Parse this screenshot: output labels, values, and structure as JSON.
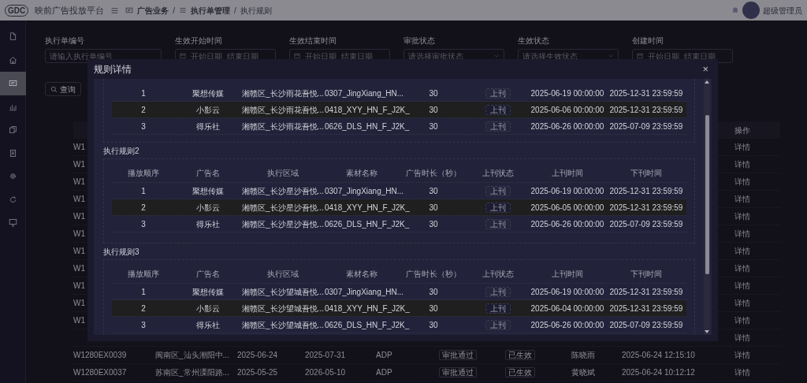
{
  "header": {
    "logo": "GDC",
    "app_title": "映前广告投放平台",
    "breadcrumb": [
      {
        "label": "广告业务",
        "kind": "board"
      },
      {
        "separator": "/",
        "label": "执行单管理",
        "kind": "list"
      },
      {
        "separator": "/",
        "label": "执行规则",
        "kind": "none"
      }
    ],
    "user": "超级管理员"
  },
  "sidebar": {
    "items": [
      {
        "kind": "document",
        "selected": false
      },
      {
        "kind": "home",
        "selected": false
      },
      {
        "kind": "board",
        "selected": true
      },
      {
        "kind": "chart",
        "selected": false
      },
      {
        "kind": "copy",
        "selected": false
      },
      {
        "kind": "files",
        "selected": false
      },
      {
        "kind": "gear",
        "selected": false
      },
      {
        "kind": "refresh",
        "selected": false
      },
      {
        "kind": "monitor",
        "selected": false
      }
    ]
  },
  "filters": [
    {
      "label": "执行单编号",
      "kind": "text",
      "placeholder": "请输入执行单编号"
    },
    {
      "label": "生效开始时间",
      "kind": "daterange",
      "start": "开始日期",
      "end": "结束日期"
    },
    {
      "label": "生效结束时间",
      "kind": "daterange",
      "start": "开始日期",
      "end": "结束日期"
    },
    {
      "label": "审批状态",
      "kind": "select",
      "placeholder": "请选择审批状态"
    },
    {
      "label": "生效状态",
      "kind": "select",
      "placeholder": "请选择生效状态"
    },
    {
      "label": "创建时间",
      "kind": "daterange",
      "start": "开始日期",
      "end": "结束日期"
    }
  ],
  "query_button": "查询",
  "table": {
    "action_column": "操作",
    "rows": [
      {
        "column_1": "W1",
        "action": "详情"
      },
      {
        "column_1": "W1",
        "action": "详情"
      },
      {
        "column_1": "W1",
        "action": "详情"
      },
      {
        "column_1": "W1",
        "action": "详情"
      },
      {
        "column_1": "W1",
        "action": "详情"
      },
      {
        "column_1": "W1",
        "action": "详情"
      },
      {
        "column_1": "W1",
        "action": "详情"
      },
      {
        "column_1": "W1",
        "action": "详情"
      },
      {
        "column_1": "W1",
        "action": "详情"
      },
      {
        "column_1": "W1",
        "action": "详情"
      },
      {
        "column_1": "W1",
        "action": "详情"
      },
      {
        "action": "详情"
      },
      {
        "column_1": "W1280EX0039",
        "column_2": "闽南区_汕头潮阳中...",
        "column_3": "2025-06-24",
        "column_4": "2025-07-31",
        "column_5": "ADP",
        "column_6": "审批通过",
        "column_7": "已生效",
        "column_8": "陈晓雨",
        "column_9": "2025-06-24 12:15:10",
        "action": "详情"
      },
      {
        "column_1": "W1280EX0037",
        "column_2": "苏南区_常州溧阳路...",
        "column_3": "2025-05-25",
        "column_4": "2026-05-10",
        "column_5": "ADP",
        "column_6": "审批通过",
        "column_7": "已生效",
        "column_8": "黄晓斌",
        "column_9": "2025-06-24 10:12:12",
        "action": "详情"
      }
    ]
  },
  "modal": {
    "title": "规则详情",
    "close": "×",
    "groups": [
      {
        "rows": [
          {
            "order": "1",
            "ad": "聚想传媒",
            "region": "湘赣区_长沙雨花吾悦...",
            "material": "0307_JingXiang_HN...",
            "duration": "30",
            "status": "上刊",
            "start": "2025-06-19 00:00:00",
            "end": "2025-12-31 23:59:59",
            "highlighted": false
          },
          {
            "order": "2",
            "ad": "小影云",
            "region": "湘赣区_长沙雨花吾悦...",
            "material": "0418_XYY_HN_F_J2K_",
            "duration": "30",
            "status": "上刊",
            "start": "2025-06-06 00:00:00",
            "end": "2025-12-31 23:59:59",
            "highlighted": true
          },
          {
            "order": "3",
            "ad": "得乐社",
            "region": "湘赣区_长沙雨花吾悦...",
            "material": "0626_DLS_HN_F_J2K_",
            "duration": "30",
            "status": "上刊",
            "start": "2025-06-26 00:00:00",
            "end": "2025-07-09 23:59:59",
            "highlighted": false
          }
        ]
      },
      {
        "title": "执行规则2",
        "columns": [
          "播放顺序",
          "广告名",
          "执行区域",
          "素材名称",
          "广告时长（秒）",
          "上刊状态",
          "上刊时间",
          "下刊时间"
        ],
        "rows": [
          {
            "order": "1",
            "ad": "聚想传媒",
            "region": "湘赣区_长沙星沙吾悦...",
            "material": "0307_JingXiang_HN...",
            "duration": "30",
            "status": "上刊",
            "start": "2025-06-19 00:00:00",
            "end": "2025-12-31 23:59:59",
            "highlighted": false
          },
          {
            "order": "2",
            "ad": "小影云",
            "region": "湘赣区_长沙星沙吾悦...",
            "material": "0418_XYY_HN_F_J2K_",
            "duration": "30",
            "status": "上刊",
            "start": "2025-06-05 00:00:00",
            "end": "2025-12-31 23:59:59",
            "highlighted": true
          },
          {
            "order": "3",
            "ad": "得乐社",
            "region": "湘赣区_长沙星沙吾悦...",
            "material": "0626_DLS_HN_F_J2K_",
            "duration": "30",
            "status": "上刊",
            "start": "2025-06-26 00:00:00",
            "end": "2025-07-09 23:59:59",
            "highlighted": false
          }
        ]
      },
      {
        "title": "执行规则3",
        "columns": [
          "播放顺序",
          "广告名",
          "执行区域",
          "素材名称",
          "广告时长（秒）",
          "上刊状态",
          "上刊时间",
          "下刊时间"
        ],
        "rows": [
          {
            "order": "1",
            "ad": "聚想传媒",
            "region": "湘赣区_长沙望城吾悦...",
            "material": "0307_JingXiang_HN...",
            "duration": "30",
            "status": "上刊",
            "start": "2025-06-19 00:00:00",
            "end": "2025-12-31 23:59:59",
            "highlighted": false
          },
          {
            "order": "2",
            "ad": "小影云",
            "region": "湘赣区_长沙望城吾悦...",
            "material": "0418_XYY_HN_F_J2K_",
            "duration": "30",
            "status": "上刊",
            "start": "2025-06-04 00:00:00",
            "end": "2025-12-31 23:59:59",
            "highlighted": true
          },
          {
            "order": "3",
            "ad": "得乐社",
            "region": "湘赣区_长沙望城吾悦...",
            "material": "0626_DLS_HN_F_J2K_",
            "duration": "30",
            "status": "上刊",
            "start": "2025-06-26 00:00:00",
            "end": "2025-07-09 23:59:59",
            "highlighted": false
          }
        ]
      }
    ]
  }
}
